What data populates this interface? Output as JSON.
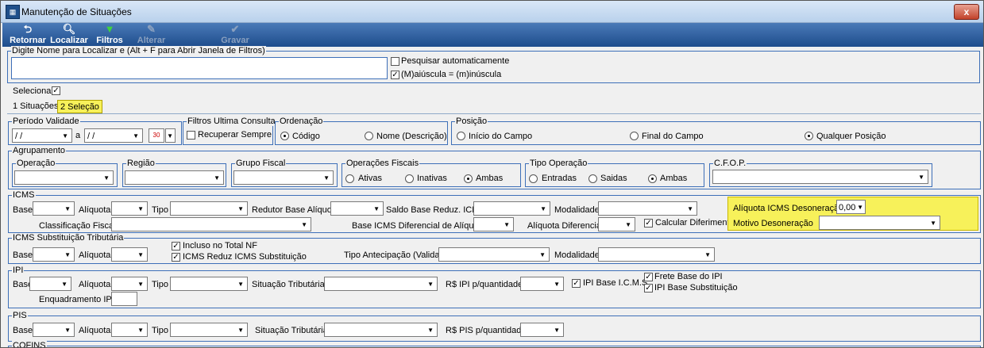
{
  "window": {
    "title": "Manutenção de Situações",
    "close": "x"
  },
  "toolbar": {
    "retornar": "Retornar",
    "localizar": "Localizar",
    "filtros": "Filtros",
    "alterar": "Alterar",
    "gravar": "Gravar"
  },
  "search": {
    "legend": "Digite Nome para Localizar e (Alt + F para Abrir Janela de Filtros)",
    "value": "",
    "auto": "Pesquisar automaticamente",
    "auto_checked": false,
    "case": "(M)aiúscula = (m)inúscula",
    "case_checked": true
  },
  "selecionar": {
    "label": "Selecionar",
    "checked": true
  },
  "tabs": {
    "situacoes": "1 Situações",
    "selecao": "2 Seleção"
  },
  "periodo": {
    "legend": "Período Validade",
    "from": "/ /",
    "conj": "a",
    "to": "/ /"
  },
  "filtros_consulta": {
    "legend": "Filtros Ultima Consulta",
    "recuperar": "Recuperar Sempre"
  },
  "ordenacao": {
    "legend": "Ordenação",
    "codigo": "Código",
    "nome": "Nome (Descrição)"
  },
  "posicao": {
    "legend": "Posição",
    "inicio": "Início do Campo",
    "final": "Final do Campo",
    "qualquer": "Qualquer Posição"
  },
  "agrupamento": {
    "legend": "Agrupamento",
    "operacao": "Operação",
    "regiao": "Região",
    "grupo_fiscal": "Grupo Fiscal",
    "op_fiscais": "Operações Fiscais",
    "ativas": "Ativas",
    "inativas": "Inativas",
    "ambas": "Ambas",
    "tipo_operacao": "Tipo Operação",
    "entradas": "Entradas",
    "saidas": "Saidas",
    "ambas2": "Ambas",
    "cfop": "C.F.O.P."
  },
  "icms": {
    "legend": "ICMS",
    "base": "Base",
    "aliquota": "Alíquota",
    "tipo": "Tipo",
    "redutor": "Redutor Base Alíquota",
    "saldo": "Saldo Base Reduz. ICMS",
    "modalidade": "Modalidade",
    "classificacao": "Classificação Fiscal",
    "base_dif": "Base ICMS Diferencial de Alíquota",
    "aliq_dif": "Alíquota Diferencial",
    "calcular": "Calcular Diferimento",
    "aliq_deson": "Alíquota ICMS Desoneração",
    "aliq_deson_value": "0,00",
    "motivo": "Motivo Desoneração"
  },
  "icms_st": {
    "legend": "ICMS Substituição Tributária",
    "base": "Base",
    "aliquota": "Alíquota",
    "incluso": "Incluso no Total NF",
    "reduz": "ICMS Reduz ICMS Substituição",
    "tipo_antec": "Tipo Antecipação (Valida)",
    "modalidade": "Modalidade"
  },
  "ipi": {
    "legend": "IPI",
    "base": "Base",
    "aliquota": "Alíquota",
    "tipo": "Tipo",
    "situacao": "Situação Tributária",
    "rs": "R$ IPI p/quantidade",
    "ipi_base_icms": "IPI Base I.C.M.S.",
    "frete": "Frete Base do IPI",
    "ipi_base_sub": "IPI Base Substituição",
    "enquadramento": "Enquadramento IPI"
  },
  "pis": {
    "legend": "PIS",
    "base": "Base",
    "aliquota": "Alíquota",
    "tipo": "Tipo",
    "situacao": "Situação Tributária",
    "rs": "R$ PIS p/quantidade"
  },
  "cofins": {
    "legend": "COFINS"
  }
}
